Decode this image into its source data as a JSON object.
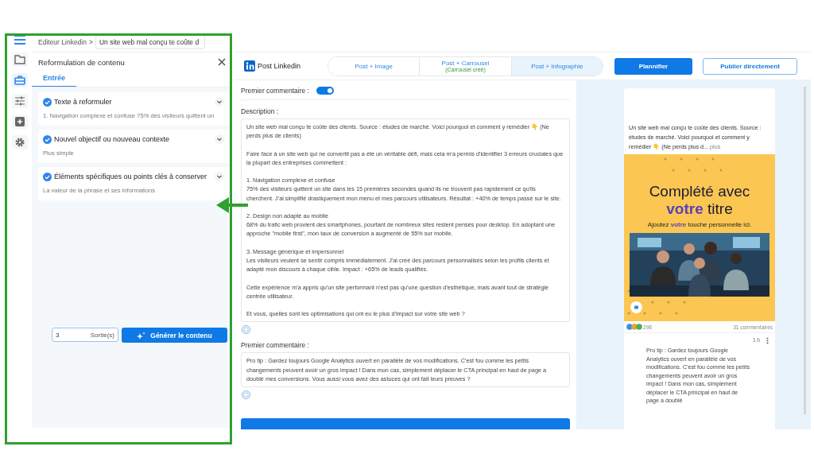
{
  "rail": {
    "items": [
      {
        "kind": "folder",
        "selected": false
      },
      {
        "kind": "briefcase",
        "selected": true
      },
      {
        "kind": "sliders",
        "selected": false
      },
      {
        "kind": "plus",
        "selected": false
      },
      {
        "kind": "gear",
        "selected": false
      }
    ]
  },
  "breadcrumb": {
    "crumb": "Editeur Linkedin",
    "separator": ">",
    "field_value": "Un site web mal conçu te coûte d"
  },
  "panel": {
    "title": "Reformulation de contenu",
    "tabs": [
      {
        "label": "Entrée",
        "selected": true
      }
    ],
    "fields": [
      {
        "label": "Texte à reformuler",
        "value": "1. Navigation complexe et confuse 75% des visiteurs quittent un",
        "checked": true
      },
      {
        "label": "Nouvel objectif ou nouveau contexte",
        "value": "Plus simple",
        "checked": true
      },
      {
        "label": "Éléments spécifiques ou points clés à conserver",
        "value": "La valeur de la phrase et ses informations",
        "checked": true
      }
    ],
    "output_count": {
      "value": "3",
      "suffix": "Sortie(s)"
    },
    "generate_button": "Générer le contenu"
  },
  "header": {
    "title": "Post Linkedin",
    "post_types": [
      {
        "label": "Post + Image",
        "selected": false
      },
      {
        "label": "Post + Carrousel",
        "note": "(Carrousel créé)",
        "selected": false
      },
      {
        "label": "Post + Infographie",
        "selected": true
      }
    ],
    "actions": [
      {
        "label": "Plannifier",
        "kind": "primary"
      },
      {
        "label": "Publier directement",
        "kind": "outline"
      }
    ]
  },
  "editor": {
    "toggle": {
      "label": "Premier commentaire :",
      "on": true
    },
    "description_label": "Description :",
    "description": [
      "Un site web mal conçu te coûte des clients. Source : études de marché. Voici pourquoi et comment y remédier 👇 (Ne perds plus de clients)",
      "Faire face à un site web qui ne convertit pas a été un véritable défi, mais cela m'a permis d'identifier 3 erreurs cruciales que la plupart des entreprises commettent :",
      "1. Navigation complexe et confuse\n75% des visiteurs quittent un site dans les 15 premières secondes quand ils ne trouvent pas rapidement ce qu'ils cherchent. J'ai simplifié drastiquement mon menu et mes parcours utilisateurs. Résultat : +40% de temps passé sur le site.",
      "2. Design non adapté au mobile\n68% du trafic web provient des smartphones, pourtant de nombreux sites restent pensés pour desktop. En adoptant une approche \"mobile first\", mon taux de conversion a augmenté de 55% sur mobile.",
      "3. Message générique et impersonnel\nLes visiteurs veulent se sentir compris immédiatement. J'ai créé des parcours personnalisés selon les profils clients et adapté mon discours à chaque cible. Impact : +65% de leads qualifiés.",
      "Cette expérience m'a appris qu'un site performant n'est pas qu'une question d'esthétique, mais avant tout de stratégie centrée utilisateur.",
      "Et vous, quelles sont les optimisations qui ont eu le plus d'impact sur votre site web ?"
    ],
    "comment_label": "Premier commentaire :",
    "comment": "Pro tip : Gardez toujours Google Analytics ouvert en parallèle de vos modifications. C'est fou comme les petits changements peuvent avoir un gros impact ! Dans mon cas, simplement déplacer le CTA principal en haut de page a doublé mes conversions. Vous aussi vous avez des astuces qui ont fait leurs preuves ?"
  },
  "preview": {
    "post_text": "Un site web mal conçu te coûte des clients. Source : études de marché. Voici pourquoi et comment y remédier 👇 (Ne perds plus d...",
    "more": "plus",
    "infographic": {
      "title_line_1": "Complété avec",
      "title_line_2": "**votre** titre",
      "subtitle": "Ajoutez **votre** touche personnelle ici."
    },
    "reactions": "298",
    "comments_count": "31 commentaires",
    "comment_time": "1 h",
    "comment": "Pro tip : Gardez toujours Google Analytics ouvert en parallèle de vos modifications. C'est fou comme les petits changements peuvent avoir un gros impact ! Dans mon cas, simplement déplacer le CTA principal en haut de page a doublé"
  }
}
